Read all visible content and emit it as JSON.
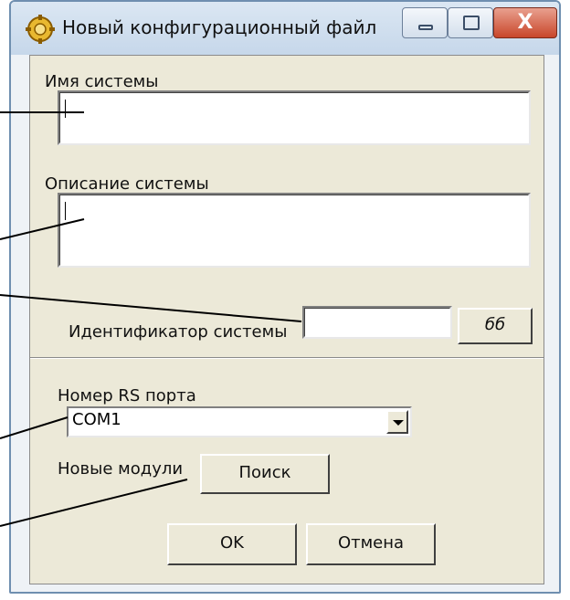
{
  "window": {
    "title": "Новый конфигурационный файл",
    "close_glyph": "X"
  },
  "form": {
    "system_name_label": "Имя системы",
    "system_name_value": "",
    "description_label": "Описание системы",
    "description_value": "",
    "system_id_label": "Идентификатор системы",
    "system_id_value": "",
    "browse_button_label": "бб",
    "rs_port_label": "Номер RS порта",
    "rs_port_value": "COM1",
    "new_modules_label": "Новые модули",
    "search_button_label": "Поиск",
    "ok_button_label": "OK",
    "cancel_button_label": "Отмена"
  },
  "colors": {
    "dialog_bg": "#ece9d8",
    "titlebar": "#c6d7ea",
    "close_button": "#c8462a"
  }
}
